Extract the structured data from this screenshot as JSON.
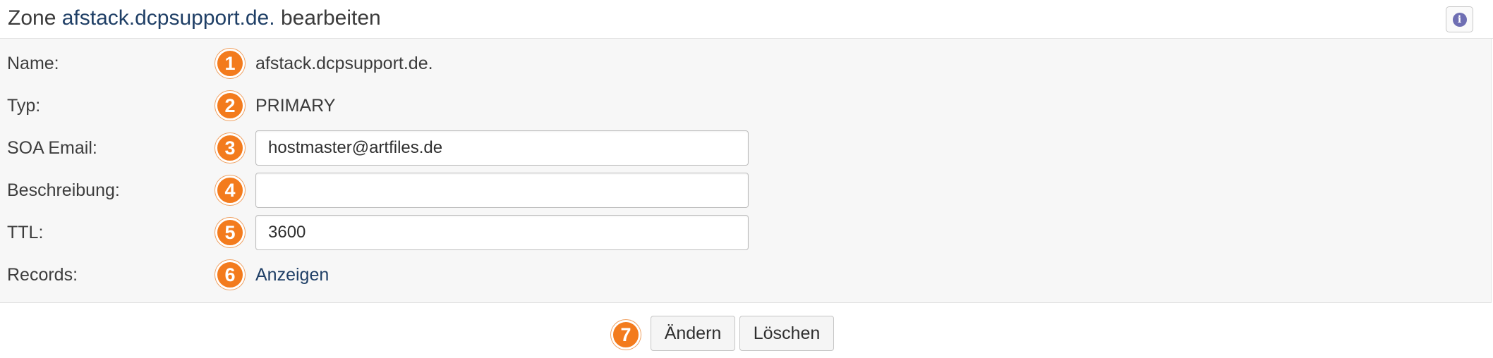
{
  "header": {
    "title_prefix": "Zone",
    "zone_name": "afstack.dcpsupport.de.",
    "title_suffix": "bearbeiten",
    "info_icon": "i"
  },
  "form": {
    "name": {
      "label": "Name:",
      "marker": "1",
      "value": "afstack.dcpsupport.de."
    },
    "type": {
      "label": "Typ:",
      "marker": "2",
      "value": "PRIMARY"
    },
    "soa_email": {
      "label": "SOA Email:",
      "marker": "3",
      "value": "hostmaster@artfiles.de",
      "placeholder": ""
    },
    "description": {
      "label": "Beschreibung:",
      "marker": "4",
      "value": "",
      "placeholder": ""
    },
    "ttl": {
      "label": "TTL:",
      "marker": "5",
      "value": "3600",
      "placeholder": ""
    },
    "records": {
      "label": "Records:",
      "marker": "6",
      "link": "Anzeigen"
    }
  },
  "actions": {
    "marker": "7",
    "change_label": "Ändern",
    "delete_label": "Löschen"
  },
  "colors": {
    "marker_orange": "#f37b1d",
    "link_blue": "#1f3f66",
    "panel_background": "#f7f7f7",
    "info_icon": "#6f6fb3"
  }
}
